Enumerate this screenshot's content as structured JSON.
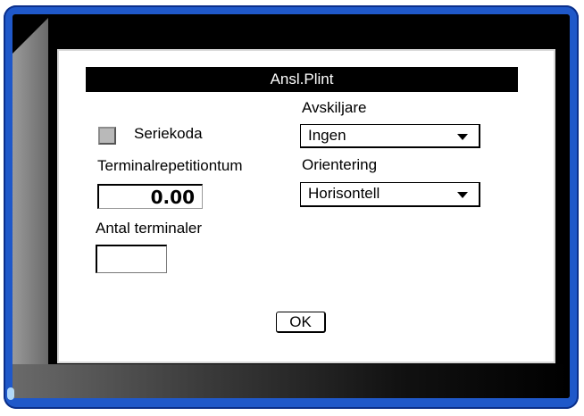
{
  "dialog": {
    "title": "Ansl.Plint",
    "serial_checkbox_label": "Seriekoda",
    "serial_checked": false,
    "repeat_label": "Terminalrepetitiontum",
    "repeat_value": "0.00",
    "count_label": "Antal terminaler",
    "count_value": "",
    "separator_label": "Avskiljare",
    "separator_value": "Ingen",
    "orientation_label": "Orientering",
    "orientation_value": "Horisontell",
    "ok_label": "OK"
  }
}
